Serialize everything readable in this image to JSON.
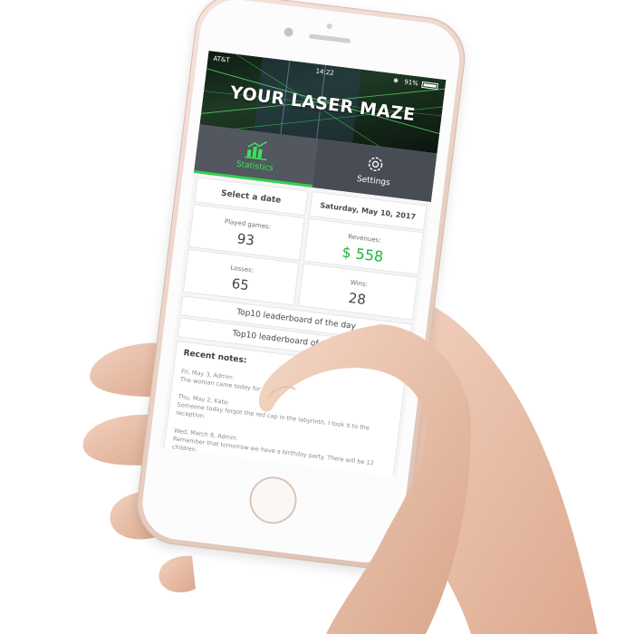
{
  "status_bar": {
    "carrier": "AT&T",
    "time": "14:22",
    "battery": "91%"
  },
  "header": {
    "title": "YOUR LASER MAZE"
  },
  "tabs": [
    {
      "label": "Statistics",
      "icon": "chart-icon",
      "active": true
    },
    {
      "label": "Settings",
      "icon": "gear-icon",
      "active": false
    }
  ],
  "stats": {
    "select_date_label": "Select a date",
    "date": "Saturday, May 10, 2017",
    "played_games_label": "Played games:",
    "played_games": "93",
    "losses_label": "Losses:",
    "losses": "65",
    "revenues_label": "Revenues:",
    "revenues": "$ 558",
    "wins_label": "Wins:",
    "wins": "28"
  },
  "leaderboards": {
    "day": "Top10 leaderboard of the day",
    "year": "Top10 leaderboard of the year"
  },
  "notes": {
    "title": "Recent notes:",
    "items": [
      {
        "head": "Fri, May 3, Admin:",
        "text": "The woman came today for this N..."
      },
      {
        "head": "Thu, May 2, Kate:",
        "text": "Someone today forgot the red cap in the labyrinth, I took it to the reception."
      },
      {
        "head": "Wed, March 8, Admin:",
        "text": "Remember that tomorrow we have a birthday party. There will be 12 children."
      }
    ]
  },
  "colors": {
    "accent_green": "#2fd24a",
    "revenue_green": "#1eb53a",
    "tab_bg": "#484c55"
  }
}
